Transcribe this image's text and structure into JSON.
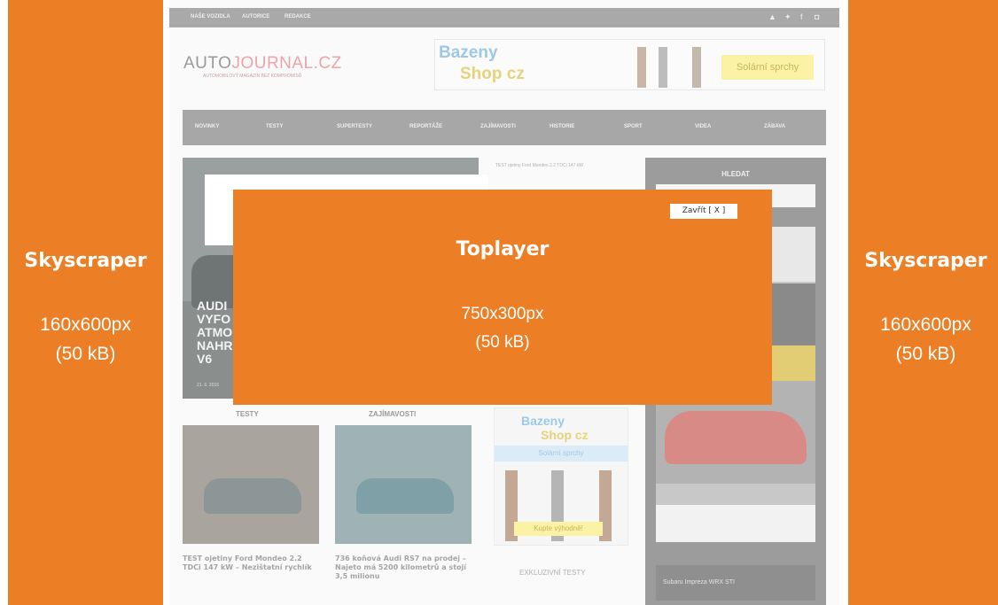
{
  "left_skyscraper": {
    "title": "Skyscraper",
    "size": "160x600px",
    "weight": "(50 kB)"
  },
  "right_skyscraper": {
    "title": "Skyscraper",
    "size": "160x600px",
    "weight": "(50 kB)"
  },
  "site": {
    "topbar_links": [
      "NAŠE VOZIDLA",
      "AUTORICE",
      "REDAKCE"
    ],
    "social_icons": [
      "youtube-icon",
      "twitter-icon",
      "facebook-icon",
      "instagram-icon"
    ],
    "logo_main": "AUTO",
    "logo_accent": "JOURNAL.CZ",
    "logo_tagline": "AUTOMOBILOVÝ MAGAZÍN BEZ KOMPROMISŮ",
    "banner": {
      "brand_top": "Bazeny",
      "brand_bottom": "Shop cz",
      "cta": "Solární sprchy"
    },
    "nav": [
      "NOVINKY",
      "TESTY",
      "SUPERTESTY",
      "REPORTÁŽE",
      "ZAJÍMAVOSTI",
      "HISTORIE",
      "SPORT",
      "VIDEA",
      "ZÁBAVA"
    ],
    "hero": {
      "text": "AUDI\nVYFO\nATMO\nNAHR\nV6",
      "meta": "21. 6. 2016"
    },
    "mid_top": "TEST ojetiny Ford Mondeo 2.2 TDCi 147 kW",
    "section_testy": "TESTY",
    "section_zajimavosti": "ZAJÍMAVOSTI",
    "article_1": "TEST ojetiny Ford Mondeo 2.2 TDCi 147 kW – Nezištatní rychlík",
    "article_2": "736 koňová Audi RS7 na prodej – Najeto má 5200 kilometrů a stojí 3,5 milionu",
    "mid_ad": {
      "brand_top": "Bazeny",
      "brand_bottom": "Shop cz",
      "bar": "Solární sprchy",
      "cta": "Kupte výhodně!"
    },
    "exclusive": "EXKLUZIVNÍ TESTY",
    "sidebar": {
      "search_title": "HLEDAT",
      "footer": "Subaru Impreza WRX STI"
    }
  },
  "toplayer": {
    "title": "Toplayer",
    "size": "750x300px",
    "weight": "(50 kB)",
    "close_label": "Zavřít [ X ]"
  },
  "colors": {
    "accent": "#ec7f26"
  }
}
